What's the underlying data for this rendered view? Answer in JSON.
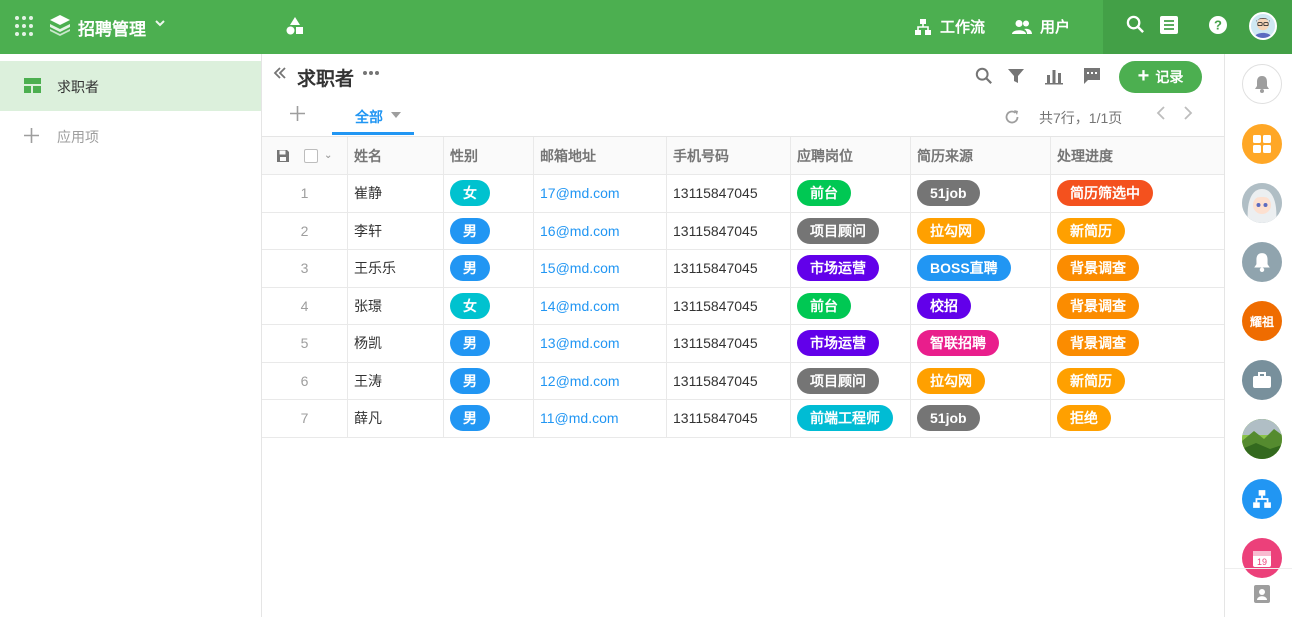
{
  "topbar": {
    "app_title": "招聘管理",
    "workflow_label": "工作流",
    "users_label": "用户",
    "icons": [
      "apps-grid-icon",
      "app-logo-icon",
      "chevron-down-icon",
      "shapes-icon",
      "workflow-icon",
      "users-icon",
      "search-icon",
      "sheet-icon",
      "help-icon",
      "avatar"
    ]
  },
  "sidebar": {
    "items": [
      {
        "label": "求职者",
        "icon": "worksheet-icon",
        "active": true
      },
      {
        "label": "应用项",
        "icon": "plus-icon",
        "active": false
      }
    ]
  },
  "worksheet": {
    "title": "求职者",
    "add_record_label": "记录",
    "toolbar_icons": [
      "search-icon",
      "filter-icon",
      "chart-icon",
      "comment-icon"
    ],
    "view_tab": "全部",
    "page_info": "共7行，1/1页"
  },
  "table": {
    "columns": [
      "姓名",
      "性别",
      "邮箱地址",
      "手机号码",
      "应聘岗位",
      "简历来源",
      "处理进度"
    ],
    "rows": [
      {
        "idx": "1",
        "name": "崔静",
        "gender": "女",
        "email": "17@md.com",
        "phone": "13115847045",
        "post": "前台",
        "source": "51job",
        "status": "简历筛选中"
      },
      {
        "idx": "2",
        "name": "李轩",
        "gender": "男",
        "email": "16@md.com",
        "phone": "13115847045",
        "post": "项目顾问",
        "source": "拉勾网",
        "status": "新简历"
      },
      {
        "idx": "3",
        "name": "王乐乐",
        "gender": "男",
        "email": "15@md.com",
        "phone": "13115847045",
        "post": "市场运营",
        "source": "BOSS直聘",
        "status": "背景调查"
      },
      {
        "idx": "4",
        "name": "张璟",
        "gender": "女",
        "email": "14@md.com",
        "phone": "13115847045",
        "post": "前台",
        "source": "校招",
        "status": "背景调查"
      },
      {
        "idx": "5",
        "name": "杨凯",
        "gender": "男",
        "email": "13@md.com",
        "phone": "13115847045",
        "post": "市场运营",
        "source": "智联招聘",
        "status": "背景调查"
      },
      {
        "idx": "6",
        "name": "王涛",
        "gender": "男",
        "email": "12@md.com",
        "phone": "13115847045",
        "post": "项目顾问",
        "source": "拉勾网",
        "status": "新简历"
      },
      {
        "idx": "7",
        "name": "薛凡",
        "gender": "男",
        "email": "11@md.com",
        "phone": "13115847045",
        "post": "前端工程师",
        "source": "51job",
        "status": "拒绝"
      }
    ]
  },
  "colors": {
    "primary_green": "#4caf50",
    "link_blue": "#2196f3",
    "gender": {
      "女": "#00c2cf",
      "男": "#2196f3"
    },
    "post": {
      "前台": "#00c853",
      "项目顾问": "#757575",
      "市场运营": "#6200ea",
      "前端工程师": "#00bcd4"
    },
    "source": {
      "51job": "#757575",
      "拉勾网": "#ffa000",
      "BOSS直聘": "#2196f3",
      "校招": "#6200ea",
      "智联招聘": "#e91e8c"
    },
    "status": {
      "简历筛选中": "#f4511e",
      "新简历": "#ffa000",
      "背景调查": "#fb8c00",
      "拒绝": "#ffa000"
    }
  },
  "right_rail": {
    "items": [
      {
        "name": "notification-bell",
        "color": "#ffffff"
      },
      {
        "name": "apps-grid",
        "color": "#ffa726"
      },
      {
        "name": "user-avatar-anime",
        "color": "#b0bec5"
      },
      {
        "name": "bell",
        "color": "#90a4ae"
      },
      {
        "name": "text-avatar",
        "color": "#ef6c00",
        "label": "耀祖"
      },
      {
        "name": "briefcase",
        "color": "#78909c"
      },
      {
        "name": "landscape-avatar",
        "color": "#689f38"
      },
      {
        "name": "org-chart",
        "color": "#2196f3"
      },
      {
        "name": "calendar",
        "color": "#ec407a",
        "label": "19"
      }
    ]
  }
}
